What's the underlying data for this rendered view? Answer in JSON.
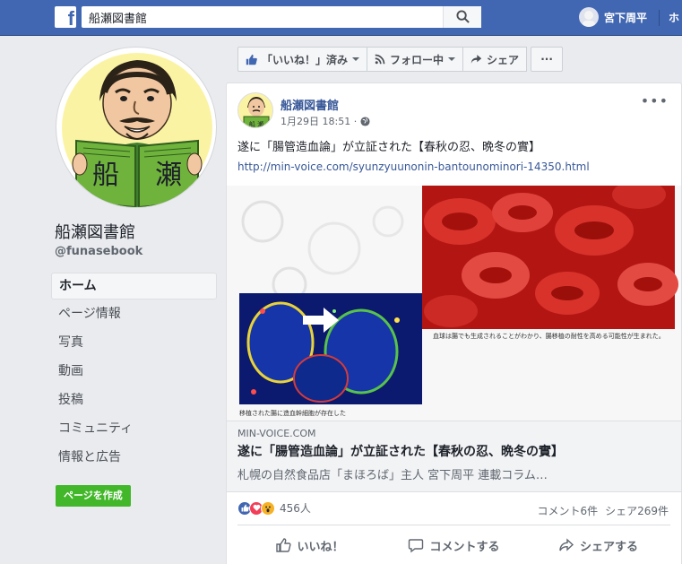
{
  "header": {
    "logo": "f",
    "search_value": "船瀬図書館",
    "user_name": "宮下周平",
    "home_label": "ホ"
  },
  "profile": {
    "picture_text": "船 瀬",
    "page_name": "船瀬図書館",
    "handle": "@funasebook"
  },
  "left_nav": [
    {
      "label": "ホーム",
      "active": true
    },
    {
      "label": "ページ情報"
    },
    {
      "label": "写真"
    },
    {
      "label": "動画"
    },
    {
      "label": "投稿"
    },
    {
      "label": "コミュニティ"
    },
    {
      "label": "情報と広告"
    }
  ],
  "create_page_label": "ページを作成",
  "actions_bar": {
    "like_label": "「いいね！」済み",
    "follow_label": "フォロー中",
    "share_label": "シェア",
    "more_label": "···"
  },
  "post": {
    "author": "船瀬図書館",
    "time": "1月29日 18:51 ·",
    "menu": "•••",
    "text": "遂に「腸管造血論」が立証された【春秋の忍、晩冬の實】",
    "link_url": "http://min-voice.com/syunzyuunonin-bantounominori-14350.html",
    "image_caption_right": "血球は腸でも生成されることがわかり、腸移植の耐性を高める可能性が生まれた。",
    "image_caption_left": "移植された腸に造血幹細胞が存在した",
    "link_domain": "MIN-VOICE.COM",
    "link_title": "遂に「腸管造血論」が立証された【春秋の忍、晩冬の實】",
    "link_desc": "札幌の自然食品店「まほろば」主人 宮下周平 連載コラム…",
    "reaction_count": "456人",
    "comments": "コメント6件",
    "shares": "シェア269件",
    "like_action": "いいね！",
    "comment_action": "コメントする",
    "share_action": "シェアする"
  },
  "colors": {
    "brand": "#4267b2",
    "link": "#385898",
    "create_button": "#42b72a"
  }
}
